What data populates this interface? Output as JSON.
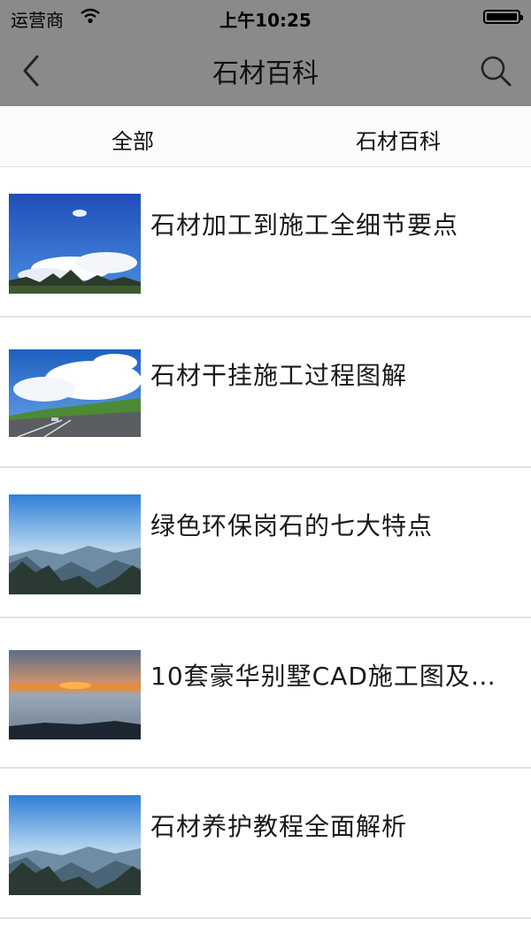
{
  "status_bar": {
    "carrier": "运营商",
    "time": "上午10:25"
  },
  "nav": {
    "title": "石材百科"
  },
  "tabs": [
    {
      "label": "全部"
    },
    {
      "label": "石材百科"
    }
  ],
  "articles": [
    {
      "title": "石材加工到施工全细节要点"
    },
    {
      "title": "石材干挂施工过程图解"
    },
    {
      "title": "绿色环保岗石的七大特点"
    },
    {
      "title": "10套豪华别墅CAD施工图及…"
    },
    {
      "title": "石材养护教程全面解析"
    }
  ]
}
